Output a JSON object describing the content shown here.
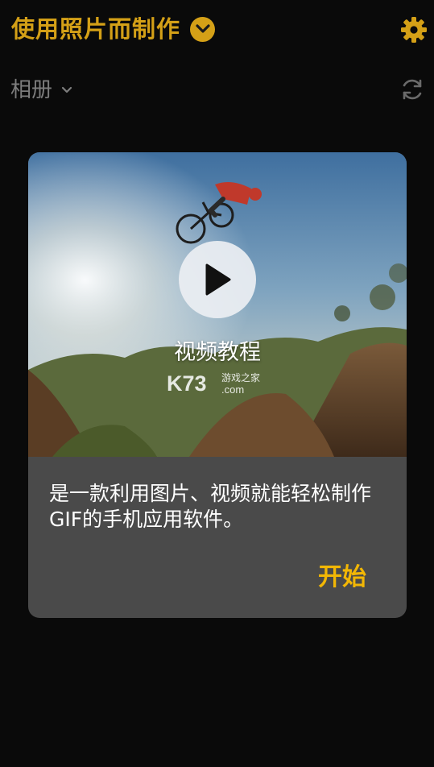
{
  "header": {
    "title": "使用照片而制作",
    "album_label": "相册"
  },
  "dialog": {
    "video_title": "视频教程",
    "watermark_brand": "K73",
    "watermark_site": "游戏之家",
    "watermark_domain": ".com",
    "description": "是一款利用图片、视频就能轻松制作GIF的手机应用软件。",
    "start_label": "开始"
  },
  "colors": {
    "accent": "#d4a017",
    "start_button": "#f2b705",
    "background": "#0a0a0a",
    "dialog_background": "#4a4a4a",
    "muted_text": "#7d7d7d"
  },
  "icons": {
    "title_dropdown": "chevron-down-icon",
    "settings": "gear-icon",
    "album_dropdown": "chevron-down-icon",
    "refresh": "refresh-icon",
    "play": "play-icon"
  }
}
